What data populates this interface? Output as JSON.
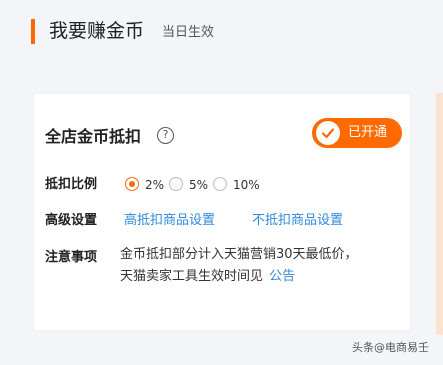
{
  "header": {
    "title": "我要赚金币",
    "subtitle": "当日生效"
  },
  "card": {
    "title": "全店金币抵扣",
    "help_icon_glyph": "?",
    "status_button": "已开通",
    "ratio": {
      "label": "抵扣比例",
      "options": [
        "2%",
        "5%",
        "10%"
      ],
      "selected": "2%"
    },
    "advanced": {
      "label": "高级设置",
      "link1": "高抵扣商品设置",
      "link2": "不抵扣商品设置"
    },
    "notice": {
      "label": "注意事项",
      "line1": "金币抵扣部分计入天猫营销30天最低价，",
      "line2": "天猫卖家工具生效时间见",
      "link": "公告"
    }
  },
  "watermark": "头条@电商易壬",
  "colors": {
    "accent": "#ff6a00",
    "link": "#3089dc"
  }
}
